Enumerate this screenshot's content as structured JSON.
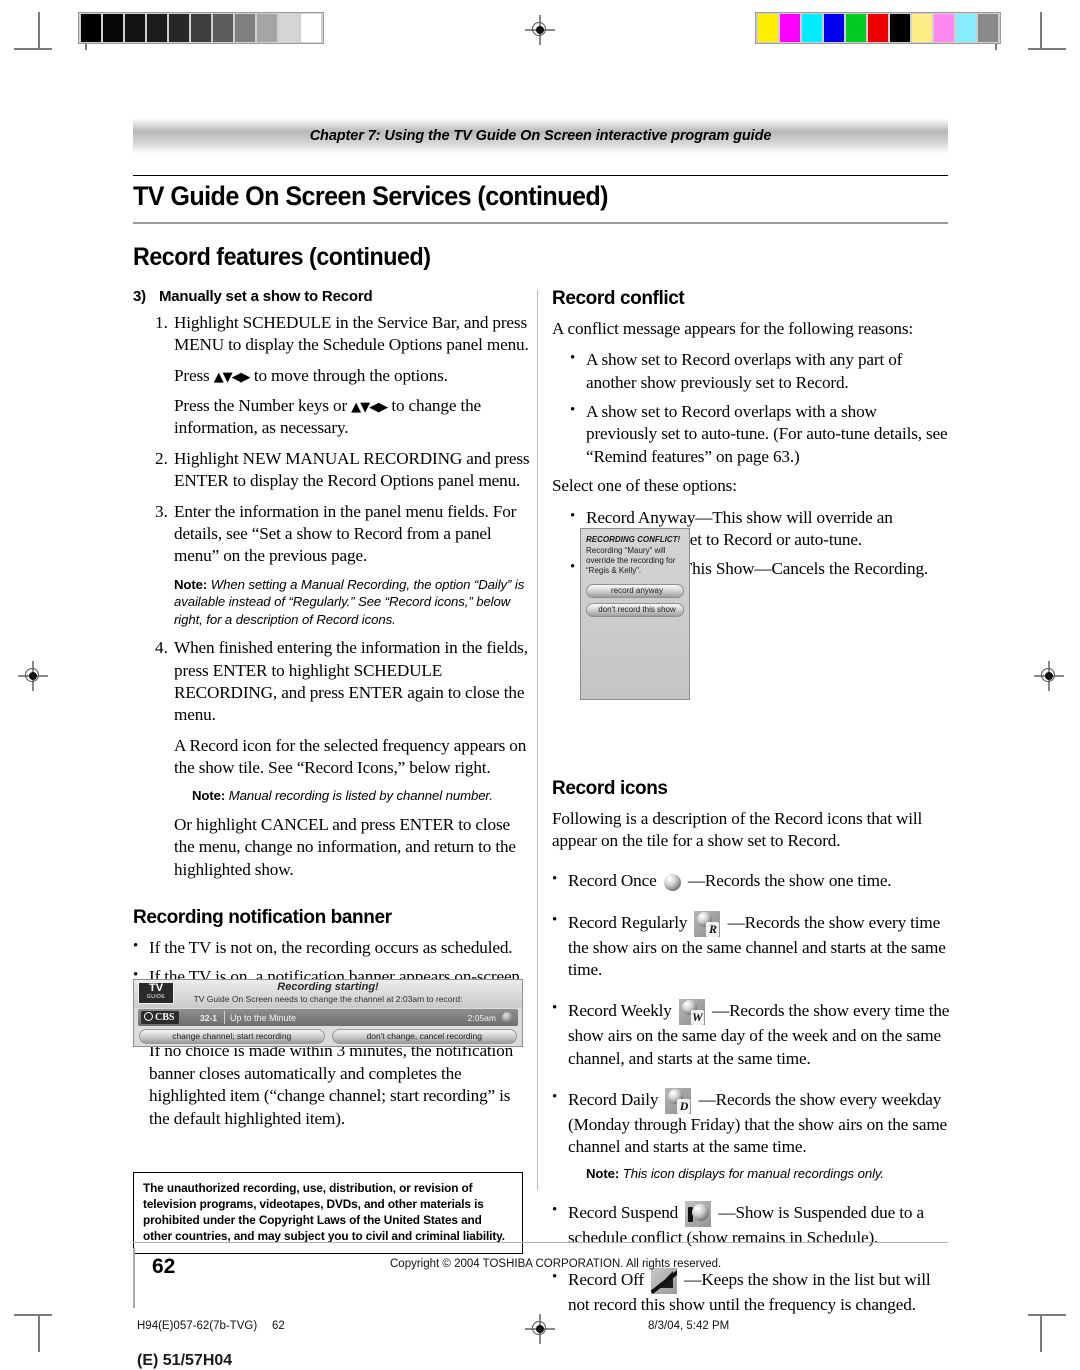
{
  "calibration": {
    "step_wedge": [
      "#000000",
      "#070707",
      "#121212",
      "#1c1c1c",
      "#272727",
      "#3e3e3e",
      "#5c5c5c",
      "#7f7f7f",
      "#a5a5a5",
      "#d5d5d5",
      "#ffffff"
    ],
    "color_bars": [
      "#ffee00",
      "#ff00ff",
      "#00eeff",
      "#0000ee",
      "#00cc22",
      "#ee0000",
      "#000000",
      "#ffee88",
      "#ff88ee",
      "#88eeff",
      "#8a8a8a"
    ],
    "registration_mark": "registration-target-icon"
  },
  "header": {
    "chapter": "Chapter 7: Using the TV Guide On Screen interactive program guide",
    "title": "TV Guide On Screen Services (continued)",
    "section": "Record features (continued)"
  },
  "left_column": {
    "heading_number": "3)",
    "heading": "Manually set a show to Record",
    "steps": [
      {
        "n": "1.",
        "text": "Highlight SCHEDULE in the Service Bar, and press MENU to display the Schedule Options panel menu."
      },
      {
        "n": "2.",
        "text": "Highlight NEW MANUAL RECORDING and press ENTER to display the Record Options panel menu."
      },
      {
        "n": "3.",
        "text": "Enter the information in the panel menu fields. For details, see “Set a show to Record from a panel menu” on the previous page."
      },
      {
        "n": "4.",
        "text": "When finished entering the information in the fields, press ENTER to highlight SCHEDULE RECORDING, and press ENTER again to close the menu."
      }
    ],
    "step1_sub_a_pre": "Press ",
    "step1_sub_a_post": " to move through the options.",
    "step1_sub_b_pre": "Press the Number keys or ",
    "step1_sub_b_post": " to change the information, as necessary.",
    "arrows": "▲▼◀▶",
    "note_daily_label": "Note:",
    "note_daily": " When setting a Manual Recording, the option “Daily” is available instead of “Regularly.” See “Record icons,” below right, for a description of Record icons.",
    "after_step4_a": "A Record icon for the selected frequency appears on the show tile. See “Record Icons,” below right.",
    "note_manual_label": "Note:",
    "note_manual": " Manual recording is listed by channel number.",
    "after_step4_b": "Or highlight CANCEL and press ENTER to close the menu, change no information, and return to the highlighted show.",
    "banner_heading": "Recording notification banner",
    "banner_bullets": [
      "If the TV is not on, the recording occurs as scheduled.",
      "If the TV is on, a notification banner appears on-screen before recording starts. At that time you can choose to start or cancel recording."
    ],
    "banner_para": "If no choice is made within 3 minutes, the notification banner closes automatically and completes the highlighted item (“change channel; start recording” is the default highlighted item).",
    "tv_banner": {
      "logo_line1": "TV",
      "logo_line2": "GUIDE",
      "title": "Recording starting!",
      "subtitle": "TV Guide On Screen needs to change the channel at  2:03am to record:",
      "network": "CBS",
      "channel": "32-1",
      "program": "Up to the Minute",
      "time": "2:05am",
      "button_left": "change channel; start recording",
      "button_right": "don't change, cancel recording"
    },
    "legal_notice": "The unauthorized recording, use, distribution, or revision of television programs, videotapes, DVDs, and other materials is prohibited under the Copyright Laws of the United States and other countries, and may subject you to civil and criminal liability."
  },
  "right_column": {
    "conflict_heading": "Record conflict",
    "conflict_intro": "A conflict message appears for the following reasons:",
    "conflict_reasons": [
      "A show set to Record overlaps with any part of another show previously set to Record.",
      "A show set to Record overlaps with a show previously set to auto-tune. (For auto-tune details, see “Remind features” on page 63.)"
    ],
    "conflict_select": "Select one of these options:",
    "conflict_options": [
      "Record Anyway—This show will override an existing show set to Record or auto-tune.",
      "Don’t Record This Show—Cancels the Recording."
    ],
    "conflict_dialog": {
      "header": "RECORDING CONFLICT!",
      "message": "Recording “Maury” will override the recording for “Regis & Kelly”.",
      "button_1": "record anyway",
      "button_2": "don't record this show"
    },
    "icons_heading": "Record icons",
    "icons_intro": "Following is a description of the Record icons that will appear on the tile for a show set to Record.",
    "icons": [
      {
        "label": "Record Once",
        "icon": "record-once-icon",
        "letter": "",
        "desc": "—Records the show one time."
      },
      {
        "label": "Record Regularly",
        "icon": "record-regularly-icon",
        "letter": "R",
        "desc": "—Records the show every time the show airs on the same channel and starts at the same time."
      },
      {
        "label": "Record Weekly",
        "icon": "record-weekly-icon",
        "letter": "W",
        "desc": "—Records the show every time the show airs on the same day of the week and on the same channel, and starts at the same time."
      },
      {
        "label": "Record Daily",
        "icon": "record-daily-icon",
        "letter": "D",
        "desc": "—Records the show every weekday (Monday through Friday) that the show airs on the same channel and starts at the same time."
      },
      {
        "label": "Record Suspend",
        "icon": "record-suspend-icon",
        "letter": "",
        "desc": "—Show is Suspended due to a schedule conflict (show remains in Schedule)."
      },
      {
        "label": "Record Off",
        "icon": "record-off-icon",
        "letter": "",
        "desc": "—Keeps the show in the list but will not record this show until the frequency is changed."
      }
    ],
    "note_daily_label": "Note:",
    "note_daily": " This icon displays for manual recordings only."
  },
  "footer": {
    "page_number": "62",
    "copyright": "Copyright © 2004 TOSHIBA CORPORATION. All rights reserved.",
    "print_file": "H94(E)057-62(7b-TVG)",
    "print_page": "62",
    "print_date": "8/3/04, 5:42 PM",
    "print_bleed": "(E) 51/57H04"
  }
}
